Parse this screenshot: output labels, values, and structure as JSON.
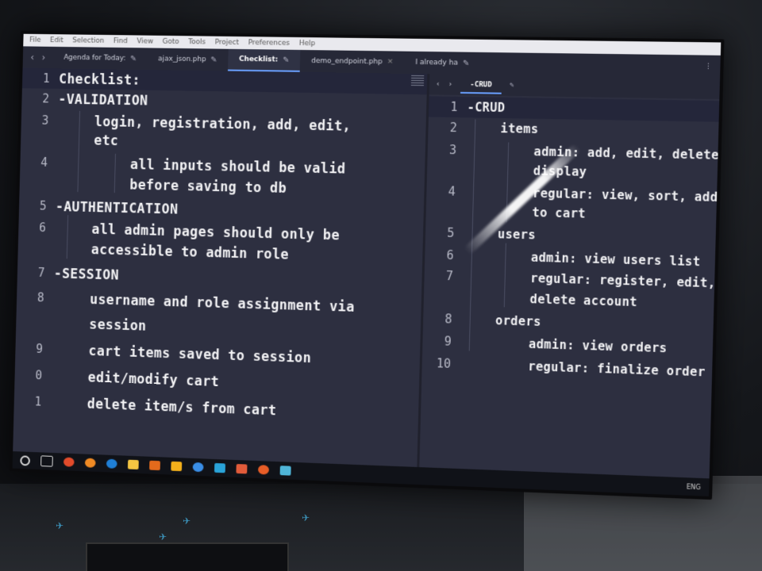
{
  "menubar": [
    "File",
    "Edit",
    "Selection",
    "Find",
    "View",
    "Goto",
    "Tools",
    "Project",
    "Preferences",
    "Help"
  ],
  "tabs": [
    {
      "label": "Agenda for Today:",
      "active": false,
      "icon": "pencil-icon"
    },
    {
      "label": "ajax_json.php",
      "active": false,
      "icon": "pencil-icon"
    },
    {
      "label": "Checklist:",
      "active": true,
      "icon": "pencil-icon"
    },
    {
      "label": "demo_endpoint.php",
      "active": false,
      "icon": "close-icon"
    },
    {
      "label": "I already ha",
      "active": false,
      "icon": "pencil-icon"
    }
  ],
  "left_code": [
    {
      "n": "1",
      "text": "Checklist:"
    },
    {
      "n": "2",
      "text": "-VALIDATION"
    },
    {
      "n": "3",
      "text": "login, registration, add, edit,"
    },
    {
      "n": "",
      "text": "etc"
    },
    {
      "n": "4",
      "text": "all inputs should be valid"
    },
    {
      "n": "",
      "text": "before saving to db"
    },
    {
      "n": "5",
      "text": "-AUTHENTICATION"
    },
    {
      "n": "6",
      "text": "all admin pages should only be"
    },
    {
      "n": "",
      "text": "accessible to admin role"
    },
    {
      "n": "7",
      "text": "-SESSION"
    },
    {
      "n": "8",
      "text": "username and role assignment via"
    },
    {
      "n": "",
      "text": "session"
    },
    {
      "n": "9",
      "text": "cart items saved to session"
    },
    {
      "n": "0",
      "text": "edit/modify cart"
    },
    {
      "n": "1",
      "text": "delete item/s from cart"
    }
  ],
  "right_tab": "-CRUD",
  "right_code": [
    {
      "n": "1",
      "text": "-CRUD"
    },
    {
      "n": "2",
      "text": "items"
    },
    {
      "n": "3",
      "text": "admin: add, edit, delete,"
    },
    {
      "n": "",
      "text": "display"
    },
    {
      "n": "4",
      "text": "regular: view, sort, add"
    },
    {
      "n": "",
      "text": "to cart"
    },
    {
      "n": "5",
      "text": "users"
    },
    {
      "n": "6",
      "text": "admin: view users list"
    },
    {
      "n": "7",
      "text": "regular: register, edit,"
    },
    {
      "n": "",
      "text": "delete account"
    },
    {
      "n": "8",
      "text": "orders"
    },
    {
      "n": "9",
      "text": "admin: view orders"
    },
    {
      "n": "10",
      "text": "regular: finalize order"
    }
  ],
  "tray_text": "ENG"
}
